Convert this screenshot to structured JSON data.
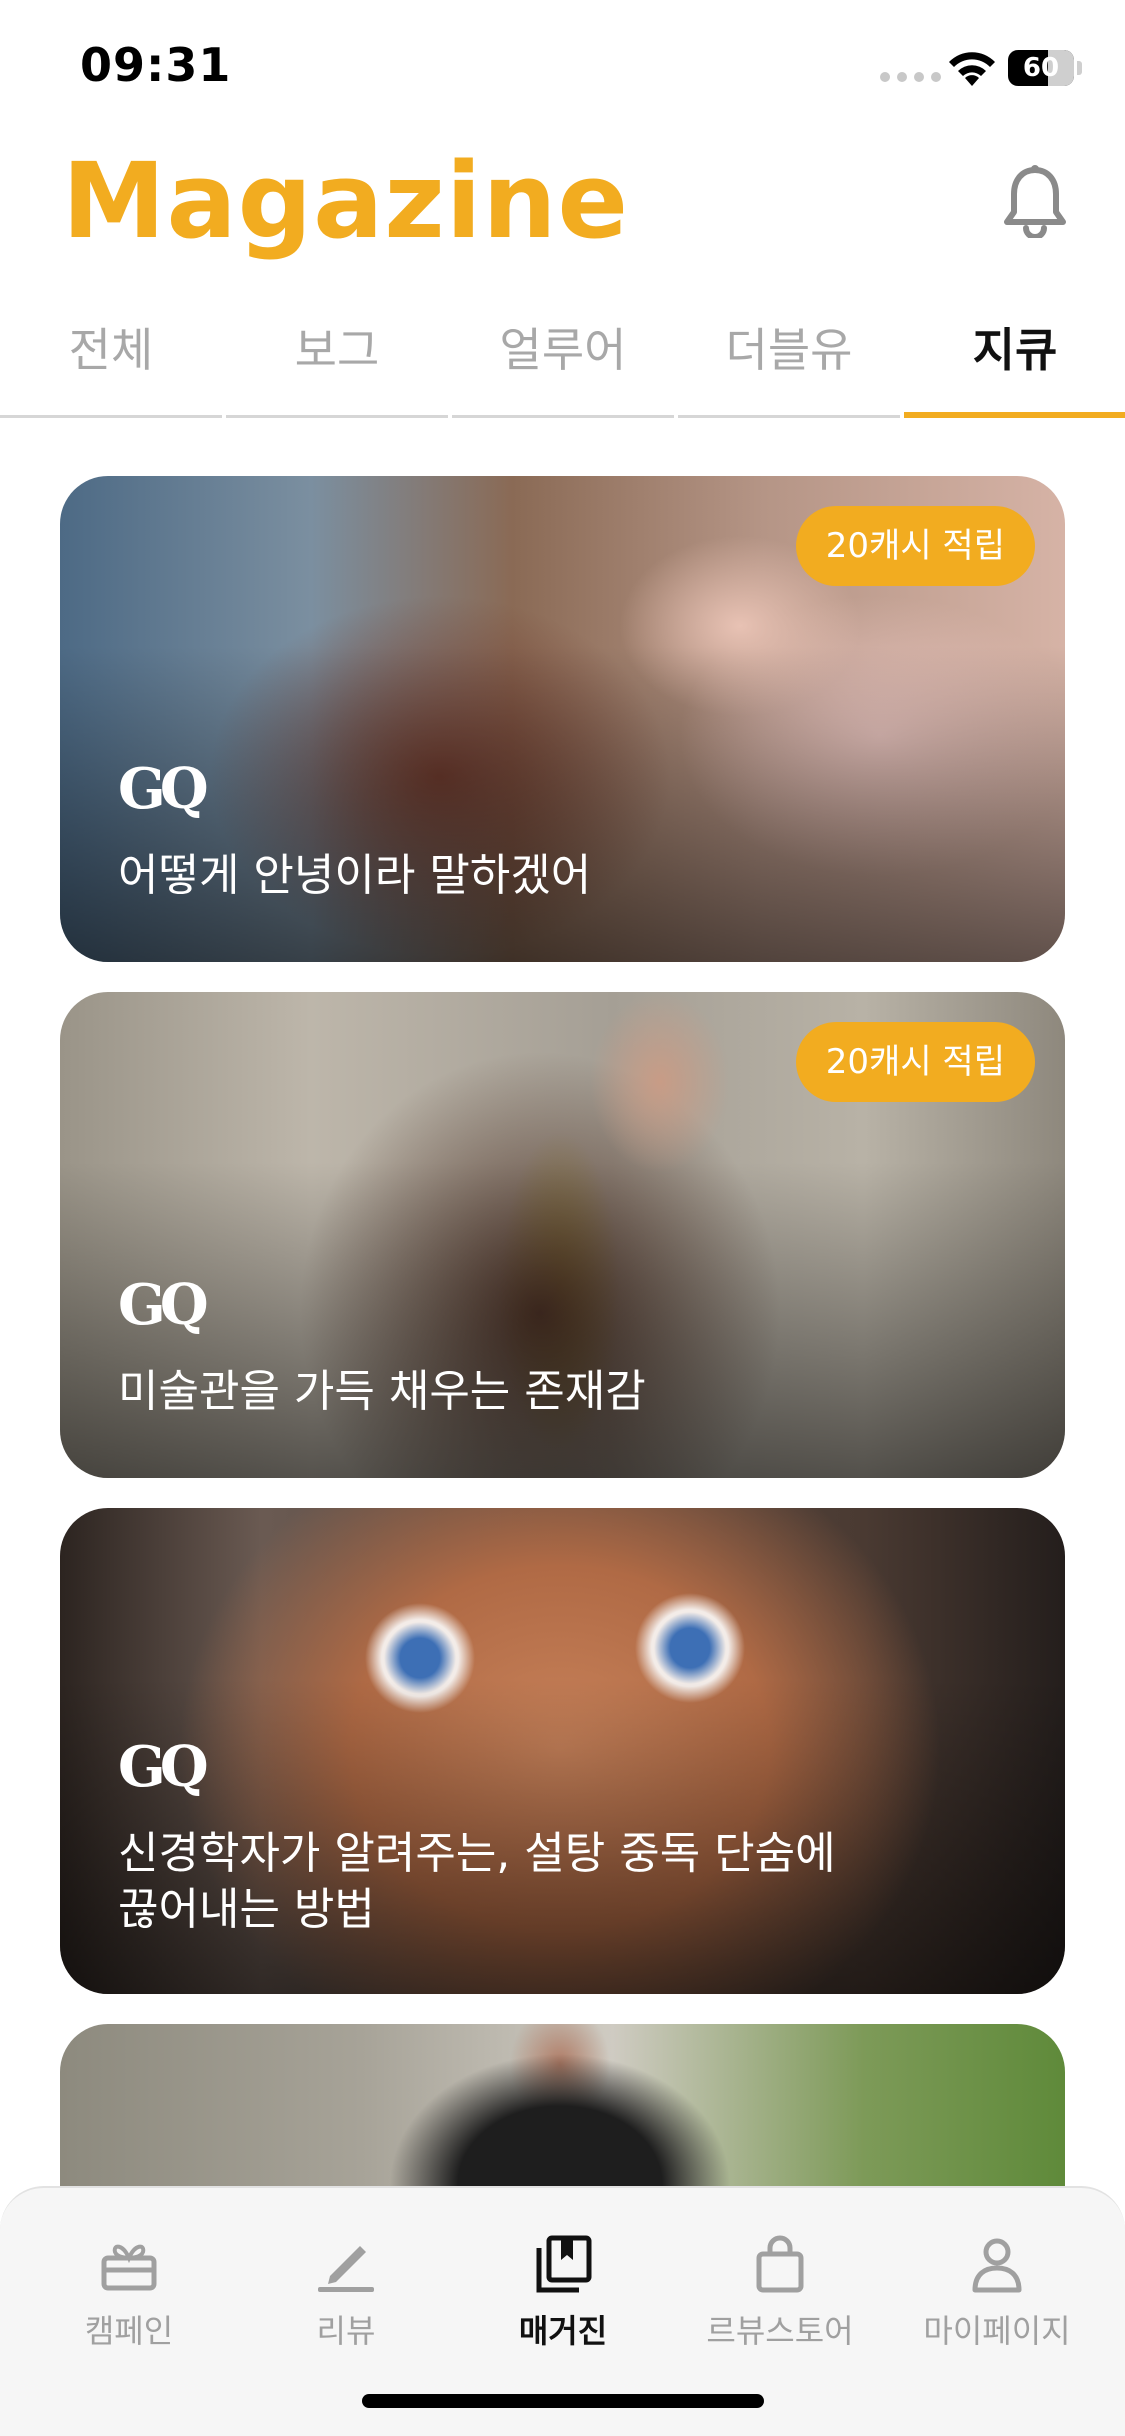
{
  "status_bar": {
    "time": "09:31",
    "battery_level": "60",
    "battery_fraction": 0.6
  },
  "header": {
    "logo_text": "Magazine"
  },
  "tabs": [
    {
      "label": "전체",
      "active": false
    },
    {
      "label": "보그",
      "active": false
    },
    {
      "label": "얼루어",
      "active": false
    },
    {
      "label": "더블유",
      "active": false
    },
    {
      "label": "지큐",
      "active": true
    }
  ],
  "articles": [
    {
      "publication": "GQ",
      "title": "어떻게 안녕이라 말하겠어",
      "badge": "20캐시 적립"
    },
    {
      "publication": "GQ",
      "title": "미술관을 가득 채우는 존재감",
      "badge": "20캐시 적립"
    },
    {
      "publication": "GQ",
      "title_line1": "신경학자가 알려주는, 설탕 중독 단숨에",
      "title_line2": "끊어내는 방법",
      "badge": ""
    }
  ],
  "bottom_nav": [
    {
      "label": "캠페인",
      "icon": "gift-box-icon",
      "active": false
    },
    {
      "label": "리뷰",
      "icon": "pencil-icon",
      "active": false
    },
    {
      "label": "매거진",
      "icon": "magazine-bookmark-icon",
      "active": true
    },
    {
      "label": "르뷰스토어",
      "icon": "shopping-bag-icon",
      "active": false
    },
    {
      "label": "마이페이지",
      "icon": "person-icon",
      "active": false
    }
  ],
  "colors": {
    "accent": "#f2ac20",
    "inactive": "#a8a8a8",
    "active_text": "#111111"
  }
}
